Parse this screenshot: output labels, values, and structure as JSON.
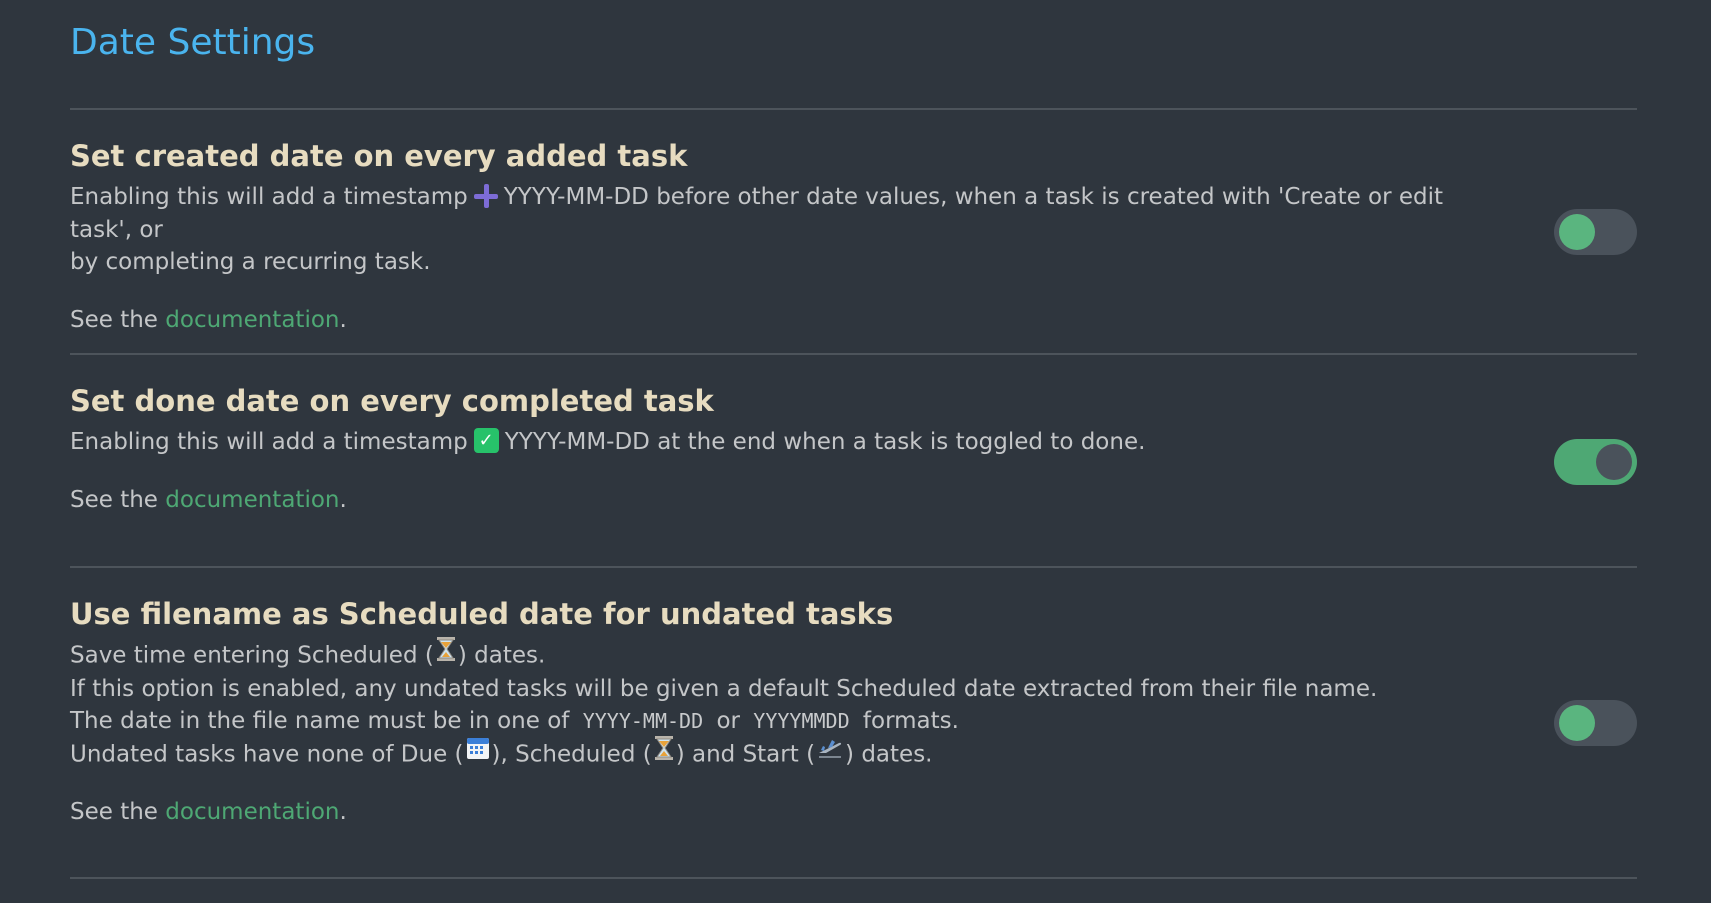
{
  "page": {
    "title": "Date Settings"
  },
  "settings": [
    {
      "name": "Set created date on every added task",
      "desc_before_icon": "Enabling this will add a timestamp",
      "icon": "plus-icon",
      "desc_after_icon": "YYYY-MM-DD before other date values, when a task is created with 'Create or edit task', or",
      "desc_line2": "by completing a recurring task.",
      "see_prefix": "See the",
      "link_label": "documentation",
      "see_suffix": ".",
      "toggle_state": "off"
    },
    {
      "name": "Set done date on every completed task",
      "desc_before_icon": "Enabling this will add a timestamp",
      "icon": "check-mark-icon",
      "desc_after_icon": "YYYY-MM-DD at the end when a task is toggled to done.",
      "see_prefix": "See the",
      "link_label": "documentation",
      "see_suffix": ".",
      "toggle_state": "on"
    },
    {
      "name": "Use filename as Scheduled date for undated tasks",
      "line1_a": "Save time entering Scheduled (",
      "line1_b": ") dates.",
      "line2": "If this option is enabled, any undated tasks will be given a default Scheduled date extracted from their file name.",
      "line3_a": "The date in the file name must be in one of",
      "line3_code1": "YYYY-MM-DD",
      "line3_or": "or",
      "line3_code2": "YYYYMMDD",
      "line3_b": "formats.",
      "line4_a": "Undated tasks have none of Due (",
      "line4_b": "), Scheduled (",
      "line4_c": ") and Start (",
      "line4_d": ") dates.",
      "icons": [
        "hourglass-icon",
        "calendar-icon",
        "airplane-departure-icon"
      ],
      "see_prefix": "See the",
      "link_label": "documentation",
      "see_suffix": ".",
      "toggle_state": "off"
    }
  ],
  "colors": {
    "background": "#2f363e",
    "title": "#4ab4ee",
    "setting_name": "#e7dcc0",
    "link": "#4ea874",
    "toggle_on": "#4ea874",
    "toggle_off": "#4a525b"
  }
}
